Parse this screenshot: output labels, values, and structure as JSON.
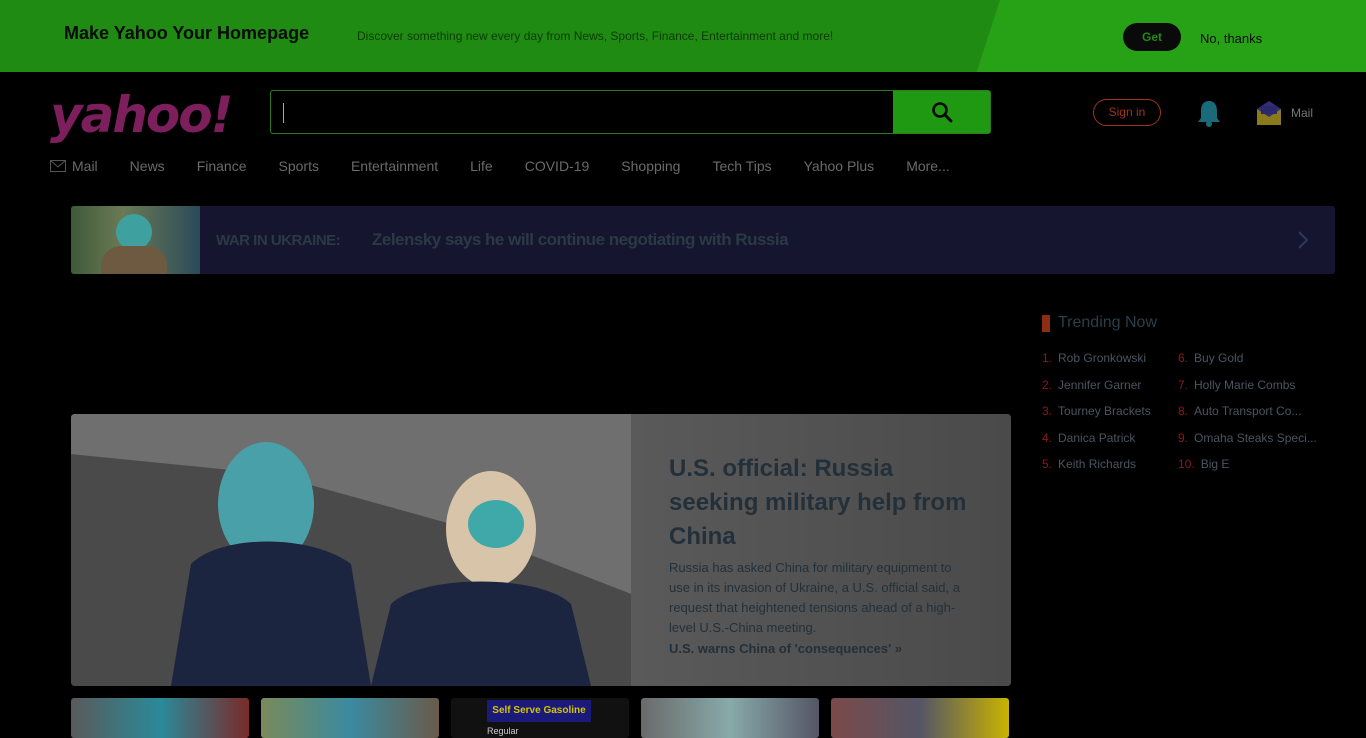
{
  "promo": {
    "title": "Make Yahoo Your Homepage",
    "subtitle": "Discover something new every day from News, Sports, Finance, Entertainment and more!",
    "get_label": "Get",
    "no_thanks_label": "No, thanks"
  },
  "header": {
    "logo_text": "yahoo!",
    "search_placeholder": "",
    "signin_label": "Sign in",
    "mail_label": "Mail"
  },
  "nav": {
    "items": [
      {
        "label": "Mail",
        "icon": "mail-icon"
      },
      {
        "label": "News"
      },
      {
        "label": "Finance"
      },
      {
        "label": "Sports"
      },
      {
        "label": "Entertainment"
      },
      {
        "label": "Life"
      },
      {
        "label": "COVID-19"
      },
      {
        "label": "Shopping"
      },
      {
        "label": "Tech Tips"
      },
      {
        "label": "Yahoo Plus"
      },
      {
        "label": "More..."
      }
    ]
  },
  "breaking": {
    "label": "WAR IN UKRAINE:",
    "headline": "Zelensky says he will continue negotiating with Russia"
  },
  "trending": {
    "title": "Trending Now",
    "left": [
      {
        "num": "1.",
        "text": "Rob Gronkowski"
      },
      {
        "num": "2.",
        "text": "Jennifer Garner"
      },
      {
        "num": "3.",
        "text": "Tourney Brackets"
      },
      {
        "num": "4.",
        "text": "Danica Patrick"
      },
      {
        "num": "5.",
        "text": "Keith Richards"
      }
    ],
    "right": [
      {
        "num": "6.",
        "text": "Buy Gold"
      },
      {
        "num": "7.",
        "text": "Holly Marie Combs"
      },
      {
        "num": "8.",
        "text": "Auto Transport Co..."
      },
      {
        "num": "9.",
        "text": "Omaha Steaks Speci..."
      },
      {
        "num": "10.",
        "text": "Big E"
      }
    ]
  },
  "hero": {
    "title": "U.S. official: Russia seeking military help from China",
    "description": "Russia has asked China for military equipment to use in its invasion of Ukraine, a U.S. official said, a request that heightened tensions ahead of a high-level U.S.-China meeting.",
    "link": "U.S. warns China of 'consequences' »"
  },
  "thumbs": {
    "gas_sign": "Self Serve Gasoline",
    "gas_regular": "Regular"
  },
  "colors": {
    "promo_bg": "#1f8b12",
    "search_btn": "#1f9912",
    "logo": "#7d1f5c",
    "breaking_bg": "#151530"
  }
}
